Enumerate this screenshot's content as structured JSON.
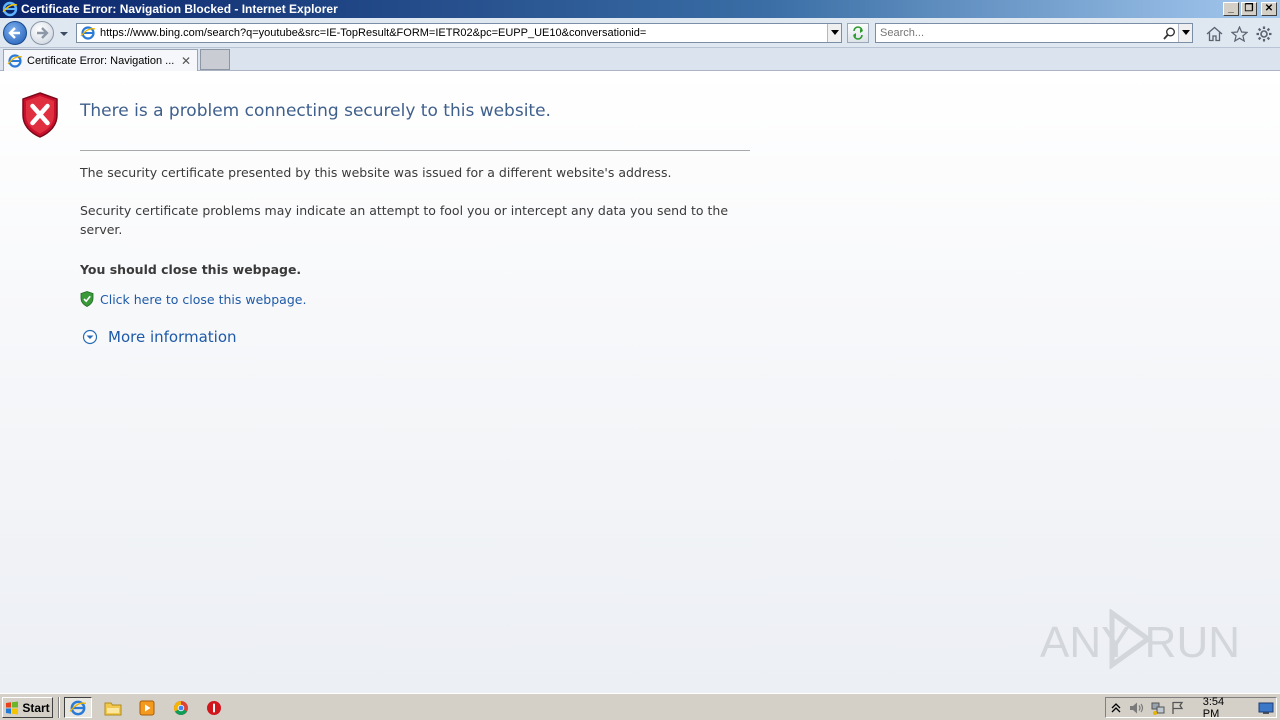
{
  "window": {
    "title": "Certificate Error: Navigation Blocked - Internet Explorer",
    "controls": {
      "minimize": "_",
      "restore": "❐",
      "close": "✕"
    }
  },
  "navbar": {
    "url": "https://www.bing.com/search?q=youtube&src=IE-TopResult&FORM=IETR02&pc=EUPP_UE10&conversationid=",
    "search_placeholder": "Search...",
    "icons": [
      "back-icon",
      "forward-icon",
      "refresh-icon",
      "search-icon",
      "home-icon",
      "favorites-icon",
      "tools-icon"
    ]
  },
  "tabs": [
    {
      "title": "Certificate Error: Navigation ...",
      "close": "✕"
    }
  ],
  "error_page": {
    "headline": "There is a problem connecting securely to this website.",
    "paragraph1": "The security certificate presented by this website was issued for a different website's address.",
    "paragraph2": "Security certificate problems may indicate an attempt to fool you or intercept any data you send to the server.",
    "recommendation": "You should close this webpage.",
    "close_link": "Click here to close this webpage.",
    "more_info": "More information"
  },
  "watermark": "ANY RUN",
  "taskbar": {
    "start_label": "Start",
    "apps": [
      "internet-explorer-icon",
      "file-explorer-icon",
      "media-player-icon",
      "chrome-icon",
      "stop-icon"
    ],
    "clock": "3:54 PM"
  },
  "colors": {
    "headline": "#3f5f8c",
    "link": "#1e5aa8",
    "error_shield": "#c8102e",
    "ok_shield": "#3a9a3a"
  }
}
